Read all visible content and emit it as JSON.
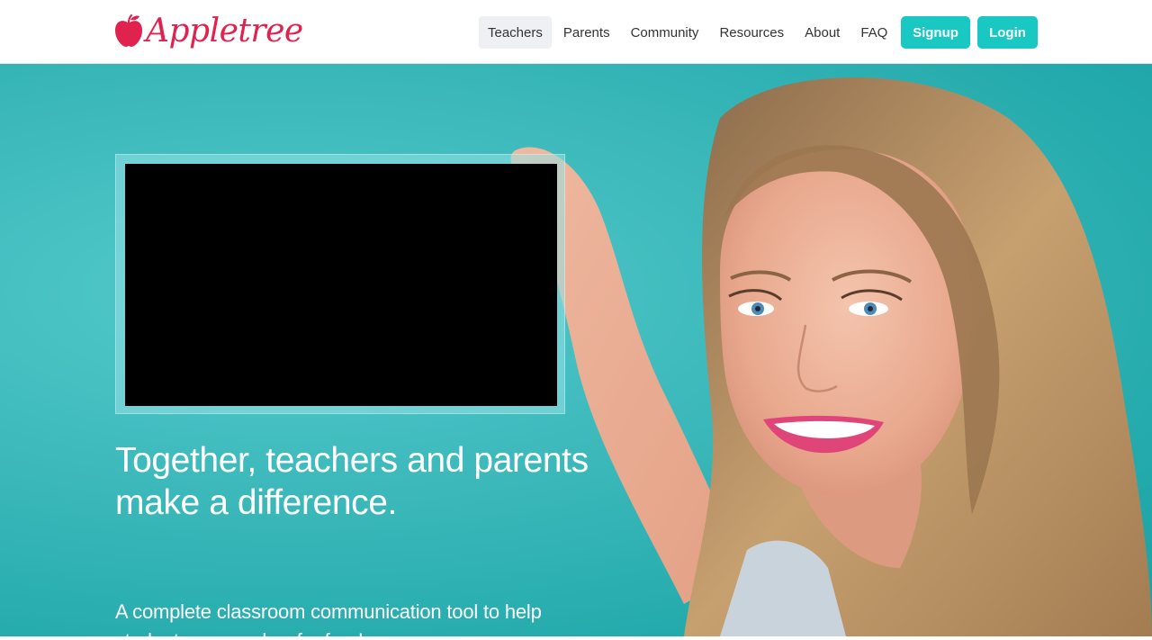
{
  "brand": {
    "name": "Appletree",
    "color": "#e0234e",
    "icon": "apple-icon"
  },
  "nav": {
    "items": [
      {
        "label": "Teachers",
        "active": true
      },
      {
        "label": "Parents",
        "active": false
      },
      {
        "label": "Community",
        "active": false
      },
      {
        "label": "Resources",
        "active": false
      },
      {
        "label": "About",
        "active": false
      },
      {
        "label": "FAQ",
        "active": false
      }
    ],
    "signup_label": "Signup",
    "login_label": "Login",
    "button_color": "#19c8c2"
  },
  "hero": {
    "headline": "Together, teachers and parents make a difference.",
    "subline": "A complete classroom communication tool to help students succeed — for free!",
    "background_color": "#3db9bb"
  }
}
